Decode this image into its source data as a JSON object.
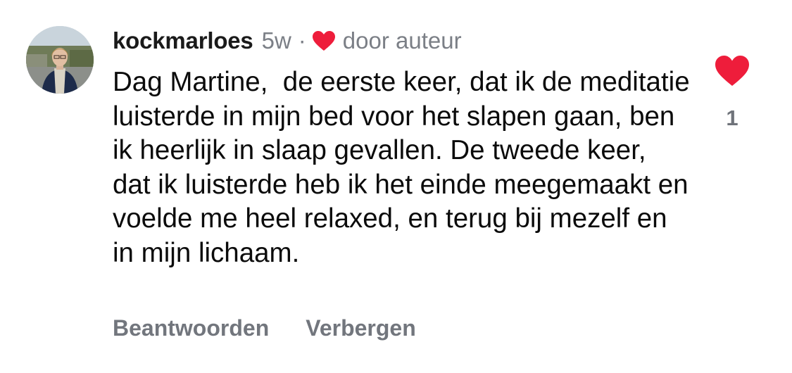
{
  "comment": {
    "author": {
      "username": "kockmarloes"
    },
    "timestamp": "5w",
    "separator": "·",
    "liked_by_author_label": "door auteur",
    "text": "Dag Martine,  de eerste keer, dat ik de meditatie luisterde in mijn bed voor het slapen gaan, ben ik heerlijk in slaap gevallen. De tweede keer, dat ik luisterde heb ik het einde meegemaakt en voelde me heel relaxed, en terug bij mezelf en in mijn lichaam.",
    "like_count": "1",
    "actions": {
      "reply_label": "Beantwoorden",
      "hide_label": "Verbergen"
    }
  },
  "colors": {
    "heart": "#ee1d3b",
    "muted_text": "#7b7f86",
    "body_text": "#0b0b0b"
  },
  "icons": {
    "author_heart": "heart-icon",
    "like": "heart-filled-icon",
    "avatar": "user-avatar-photo"
  }
}
